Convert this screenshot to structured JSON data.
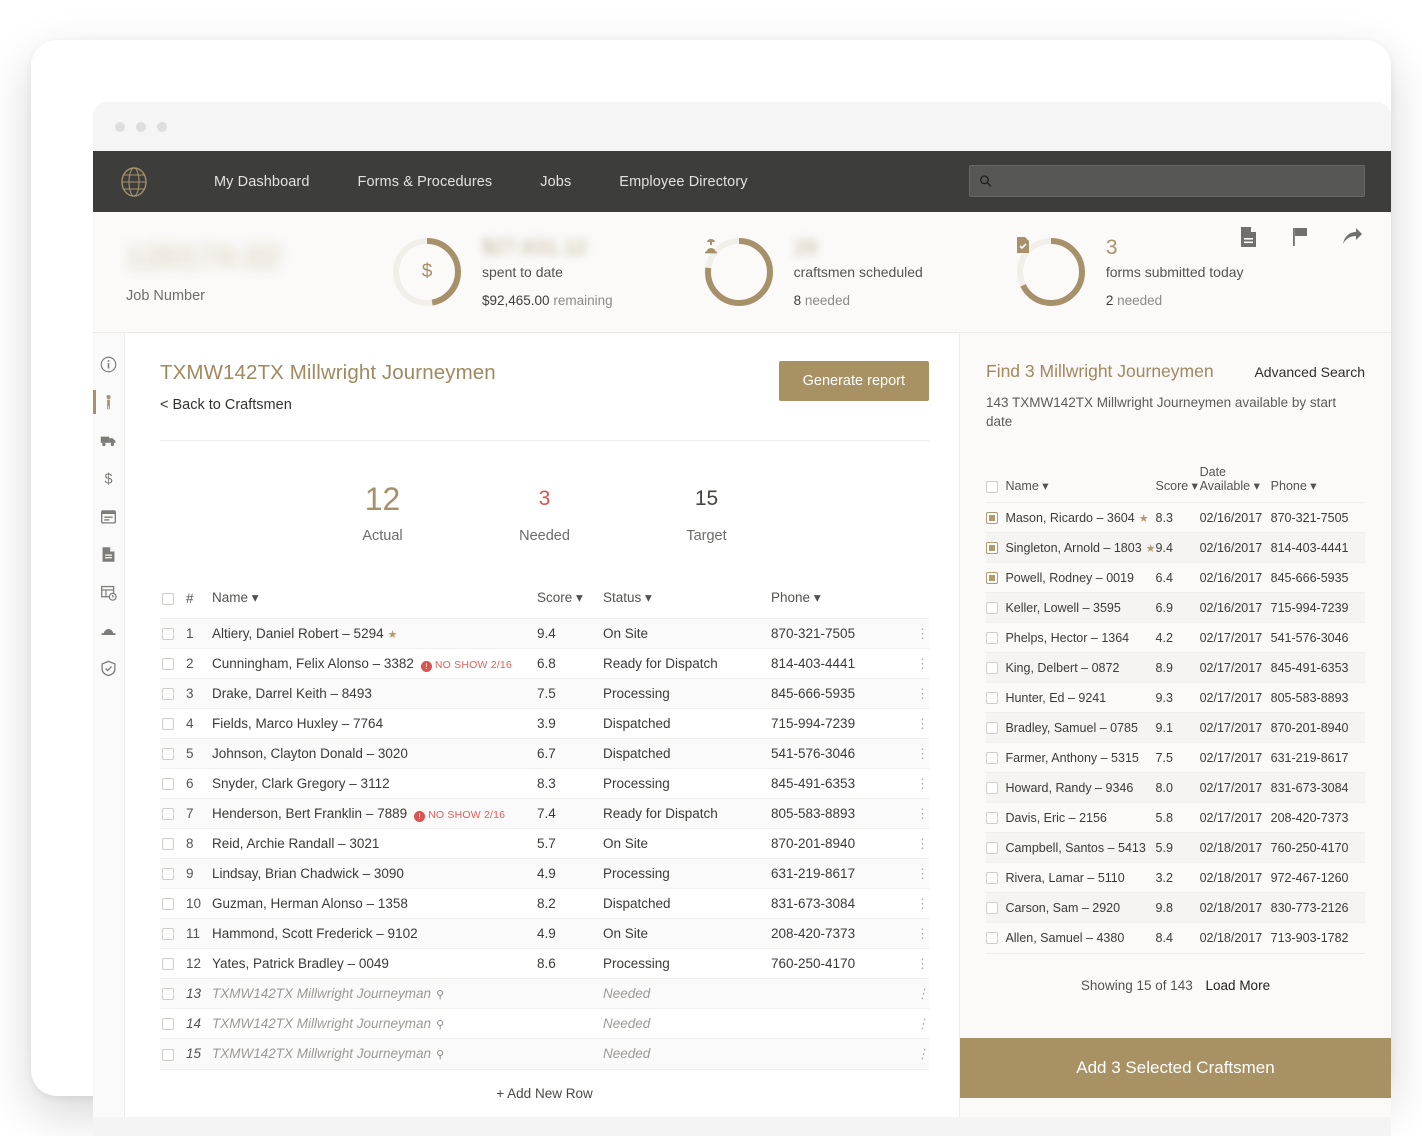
{
  "window": {
    "dots": 3
  },
  "topnav": {
    "logo": "globe-logo",
    "links": [
      "My Dashboard",
      "Forms & Procedures",
      "Jobs",
      "Employee Directory"
    ],
    "search_placeholder": "",
    "search_value": ""
  },
  "stats": {
    "job_number": {
      "value": "120174.02",
      "label": "Job Number",
      "blurred": true
    },
    "cards": [
      {
        "icon": "dollar-icon",
        "big": "$27,631.12",
        "blurred": true,
        "sub": "spent to date",
        "sub2_strong": "$92,465.00",
        "sub2_muted": "remaining",
        "percent": 23
      },
      {
        "icon": "craftsman-icon",
        "big": "29",
        "blurred": true,
        "sub": "craftsmen scheduled",
        "sub2_strong": "8",
        "sub2_muted": "needed",
        "percent": 70
      },
      {
        "icon": "form-check-icon",
        "big": "3",
        "blurred": false,
        "sub": "forms submitted today",
        "sub2_strong": "2",
        "sub2_muted": "needed",
        "percent": 62
      }
    ],
    "actions": [
      "document-icon",
      "flag-icon",
      "share-icon"
    ]
  },
  "rail": {
    "items": [
      {
        "icon": "info-icon",
        "active": false
      },
      {
        "icon": "person-icon",
        "active": true
      },
      {
        "icon": "truck-icon",
        "active": false
      },
      {
        "icon": "dollar-icon",
        "active": false
      },
      {
        "icon": "calendar-icon",
        "active": false
      },
      {
        "icon": "document-icon",
        "active": false
      },
      {
        "icon": "schedule-table-icon",
        "active": false
      },
      {
        "icon": "hardhat-icon",
        "active": false
      },
      {
        "icon": "shield-check-icon",
        "active": false
      }
    ]
  },
  "left_panel": {
    "title": "TXMW142TX Millwright Journeymen",
    "back_link": "< Back to Craftsmen",
    "generate_report": "Generate report",
    "counters": [
      {
        "num": "12",
        "label": "Actual",
        "style": "actual"
      },
      {
        "num": "3",
        "label": "Needed",
        "style": "needed"
      },
      {
        "num": "15",
        "label": "Target",
        "style": "target"
      }
    ],
    "columns": [
      "#",
      "Name",
      "Score",
      "Status",
      "Phone"
    ],
    "rows": [
      {
        "n": "1",
        "name": "Altiery, Daniel Robert – 5294",
        "star": true,
        "badge": "",
        "score": "9.4",
        "score_color": "green",
        "status": "On Site",
        "phone": "870-321-7505"
      },
      {
        "n": "2",
        "name": "Cunningham, Felix Alonso – 3382",
        "star": false,
        "badge": "NO SHOW 2/16",
        "score": "6.8",
        "score_color": "amber",
        "status": "Ready for Dispatch",
        "phone": "814-403-4441"
      },
      {
        "n": "3",
        "name": "Drake, Darrel Keith – 8493",
        "star": false,
        "badge": "",
        "score": "7.5",
        "score_color": "amber",
        "status": "Processing",
        "phone": "845-666-5935"
      },
      {
        "n": "4",
        "name": "Fields, Marco Huxley – 7764",
        "star": false,
        "badge": "",
        "score": "3.9",
        "score_color": "red",
        "status": "Dispatched",
        "phone": "715-994-7239"
      },
      {
        "n": "5",
        "name": "Johnson, Clayton Donald – 3020",
        "star": false,
        "badge": "",
        "score": "6.7",
        "score_color": "amber",
        "status": "Dispatched",
        "phone": "541-576-3046"
      },
      {
        "n": "6",
        "name": "Snyder, Clark Gregory – 3112",
        "star": false,
        "badge": "",
        "score": "8.3",
        "score_color": "green",
        "status": "Processing",
        "phone": "845-491-6353"
      },
      {
        "n": "7",
        "name": "Henderson, Bert Franklin – 7889",
        "star": false,
        "badge": "NO SHOW 2/16",
        "score": "7.4",
        "score_color": "amber",
        "status": "Ready for Dispatch",
        "phone": "805-583-8893"
      },
      {
        "n": "8",
        "name": "Reid, Archie Randall – 3021",
        "star": false,
        "badge": "",
        "score": "5.7",
        "score_color": "amber",
        "status": "On Site",
        "phone": "870-201-8940"
      },
      {
        "n": "9",
        "name": "Lindsay, Brian Chadwick – 3090",
        "star": false,
        "badge": "",
        "score": "4.9",
        "score_color": "red",
        "status": "Processing",
        "phone": "631-219-8617"
      },
      {
        "n": "10",
        "name": "Guzman, Herman Alonso – 1358",
        "star": false,
        "badge": "",
        "score": "8.2",
        "score_color": "green",
        "status": "Dispatched",
        "phone": "831-673-3084"
      },
      {
        "n": "11",
        "name": "Hammond, Scott Frederick – 9102",
        "star": false,
        "badge": "",
        "score": "4.9",
        "score_color": "red",
        "status": "On Site",
        "phone": "208-420-7373"
      },
      {
        "n": "12",
        "name": "Yates, Patrick Bradley – 0049",
        "star": false,
        "badge": "",
        "score": "8.6",
        "score_color": "green",
        "status": "Processing",
        "phone": "760-250-4170"
      },
      {
        "n": "13",
        "name": "TXMW142TX Millwright Journeyman",
        "ghost": true,
        "score": "",
        "score_color": "",
        "status": "Needed",
        "phone": ""
      },
      {
        "n": "14",
        "name": "TXMW142TX Millwright Journeyman",
        "ghost": true,
        "score": "",
        "score_color": "",
        "status": "Needed",
        "phone": ""
      },
      {
        "n": "15",
        "name": "TXMW142TX Millwright Journeyman",
        "ghost": true,
        "score": "",
        "score_color": "",
        "status": "Needed",
        "phone": ""
      }
    ],
    "add_new_row": "+  Add New Row"
  },
  "right_panel": {
    "title": "Find 3 Millwright Journeymen",
    "advanced_search": "Advanced Search",
    "subtitle": "143 TXMW142TX Millwright Journeymen available by start date",
    "columns": [
      "Name",
      "Score",
      "Date Available",
      "Phone"
    ],
    "rows": [
      {
        "selected": true,
        "name": "Mason, Ricardo – 3604",
        "star": true,
        "score": "8.3",
        "score_color": "green",
        "date": "02/16/2017",
        "phone": "870-321-7505"
      },
      {
        "selected": true,
        "name": "Singleton, Arnold – 1803",
        "star": true,
        "score": "9.4",
        "score_color": "green",
        "date": "02/16/2017",
        "phone": "814-403-4441"
      },
      {
        "selected": true,
        "name": "Powell, Rodney – 0019",
        "star": false,
        "score": "6.4",
        "score_color": "amber",
        "date": "02/16/2017",
        "phone": "845-666-5935"
      },
      {
        "selected": false,
        "name": "Keller, Lowell – 3595",
        "star": false,
        "score": "6.9",
        "score_color": "amber",
        "date": "02/16/2017",
        "phone": "715-994-7239"
      },
      {
        "selected": false,
        "name": "Phelps, Hector – 1364",
        "star": false,
        "score": "4.2",
        "score_color": "red",
        "date": "02/17/2017",
        "phone": "541-576-3046"
      },
      {
        "selected": false,
        "name": "King, Delbert – 0872",
        "star": false,
        "score": "8.9",
        "score_color": "green",
        "date": "02/17/2017",
        "phone": "845-491-6353"
      },
      {
        "selected": false,
        "name": "Hunter, Ed – 9241",
        "star": false,
        "score": "9.3",
        "score_color": "green",
        "date": "02/17/2017",
        "phone": "805-583-8893"
      },
      {
        "selected": false,
        "name": "Bradley, Samuel – 0785",
        "star": false,
        "score": "9.1",
        "score_color": "green",
        "date": "02/17/2017",
        "phone": "870-201-8940"
      },
      {
        "selected": false,
        "name": "Farmer, Anthony – 5315",
        "star": false,
        "score": "7.5",
        "score_color": "amber",
        "date": "02/17/2017",
        "phone": "631-219-8617"
      },
      {
        "selected": false,
        "name": "Howard, Randy – 9346",
        "star": false,
        "score": "8.0",
        "score_color": "green",
        "date": "02/17/2017",
        "phone": "831-673-3084"
      },
      {
        "selected": false,
        "name": "Davis, Eric – 2156",
        "star": false,
        "score": "5.8",
        "score_color": "amber",
        "date": "02/17/2017",
        "phone": "208-420-7373"
      },
      {
        "selected": false,
        "name": "Campbell, Santos – 5413",
        "star": false,
        "score": "5.9",
        "score_color": "amber",
        "date": "02/18/2017",
        "phone": "760-250-4170"
      },
      {
        "selected": false,
        "name": "Rivera, Lamar – 5110",
        "star": false,
        "score": "3.2",
        "score_color": "red",
        "date": "02/18/2017",
        "phone": "972-467-1260"
      },
      {
        "selected": false,
        "name": "Carson, Sam – 2920",
        "star": false,
        "score": "9.8",
        "score_color": "green",
        "date": "02/18/2017",
        "phone": "830-773-2126"
      },
      {
        "selected": false,
        "name": "Allen, Samuel – 4380",
        "star": false,
        "score": "8.4",
        "score_color": "green",
        "date": "02/18/2017",
        "phone": "713-903-1782"
      }
    ],
    "showing": "Showing 15 of 143",
    "load_more": "Load More",
    "add_selected": "Add 3 Selected Craftsmen"
  },
  "colors": {
    "gold": "#a89263",
    "gold_text": "#a1895f",
    "dark_nav": "#3d3d3b",
    "green": "#3fc7a4",
    "amber": "#f0a830",
    "red": "#e8534a",
    "needed_red": "#d9534f"
  }
}
